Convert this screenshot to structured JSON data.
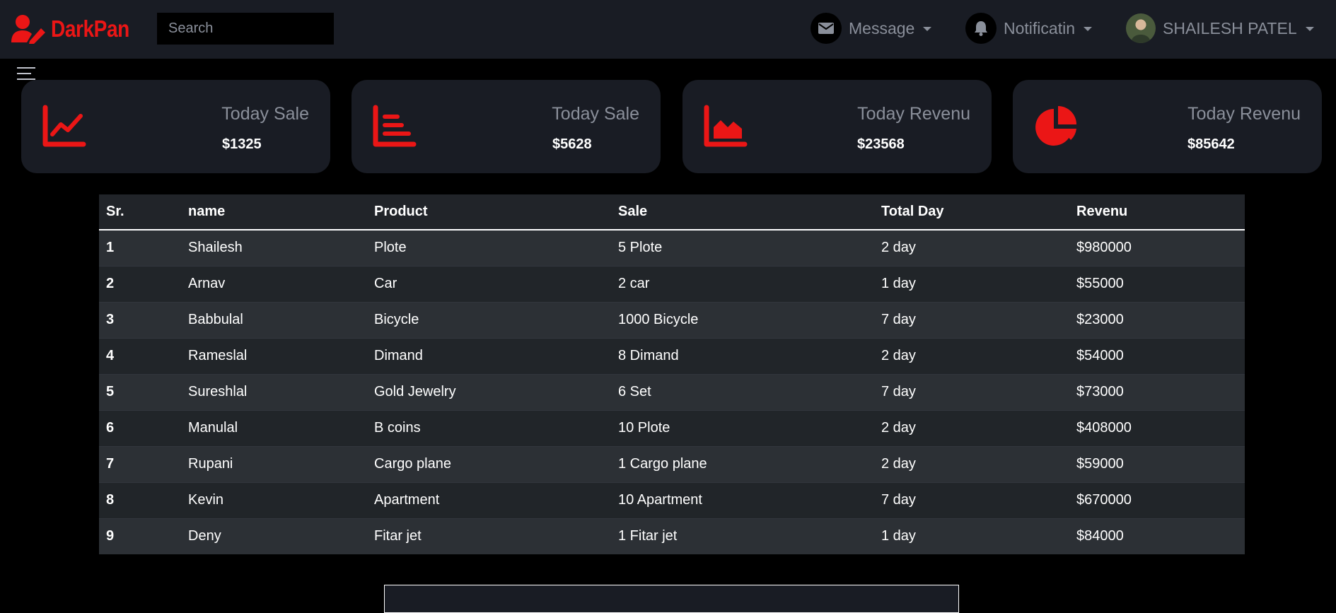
{
  "brand": {
    "name": "DarkPan",
    "color": "#eb1616"
  },
  "search": {
    "placeholder": "Search"
  },
  "nav": {
    "message": {
      "label": "Message",
      "icon": "envelope-icon"
    },
    "notification": {
      "label": "Notificatin",
      "icon": "bell-icon"
    },
    "user": {
      "name": "SHAILESH PATEL",
      "icon": "avatar"
    }
  },
  "cards": [
    {
      "label": "Today Sale",
      "value": "$1325",
      "icon": "line-chart-icon"
    },
    {
      "label": "Today Sale",
      "value": "$5628",
      "icon": "bar-chart-icon"
    },
    {
      "label": "Today Revenu",
      "value": "$23568",
      "icon": "area-chart-icon"
    },
    {
      "label": "Today Revenu",
      "value": "$85642",
      "icon": "pie-chart-icon"
    }
  ],
  "table": {
    "headers": [
      "Sr.",
      "name",
      "Product",
      "Sale",
      "Total Day",
      "Revenu"
    ],
    "rows": [
      [
        "1",
        "Shailesh",
        "Plote",
        "5 Plote",
        "2 day",
        "$980000"
      ],
      [
        "2",
        "Arnav",
        "Car",
        "2 car",
        "1 day",
        "$55000"
      ],
      [
        "3",
        "Babbulal",
        "Bicycle",
        "1000 Bicycle",
        "7 day",
        "$23000"
      ],
      [
        "4",
        "Rameslal",
        "Dimand",
        "8 Dimand",
        "2 day",
        "$54000"
      ],
      [
        "5",
        "Sureshlal",
        "Gold Jewelry",
        "6 Set",
        "7 day",
        "$73000"
      ],
      [
        "6",
        "Manulal",
        "B coins",
        "10 Plote",
        "2 day",
        "$408000"
      ],
      [
        "7",
        "Rupani",
        "Cargo plane",
        "1 Cargo plane",
        "2 day",
        "$59000"
      ],
      [
        "8",
        "Kevin",
        "Apartment",
        "10 Apartment",
        "7 day",
        "$670000"
      ],
      [
        "9",
        "Deny",
        "Fitar jet",
        "1 Fitar jet",
        "1 day",
        "$84000"
      ]
    ]
  }
}
